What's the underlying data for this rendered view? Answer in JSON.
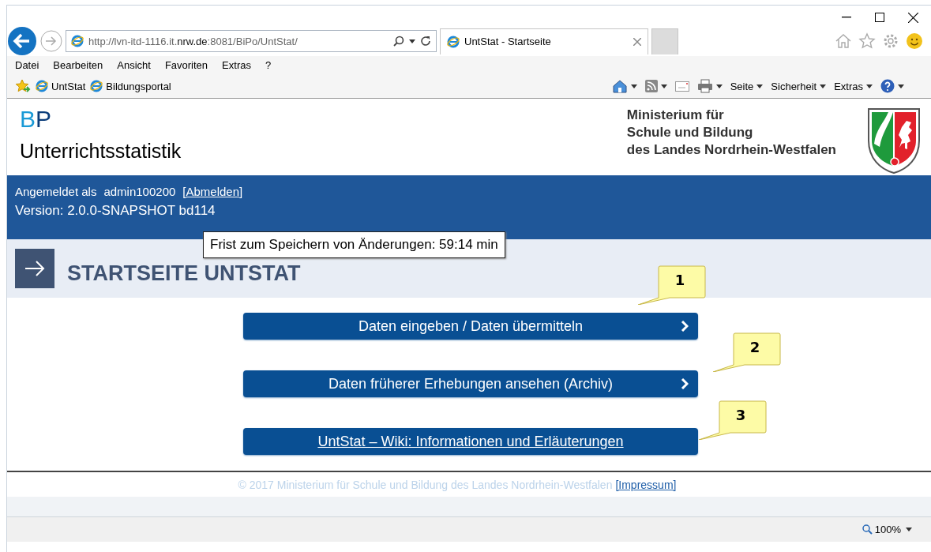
{
  "address_bar": {
    "url": "http://lvn-itd-1116.it.**nrw.de**:8081/BiPo/UntStat/"
  },
  "tabs": [
    {
      "title": "UntStat - Startseite",
      "selected": true
    }
  ],
  "menu_bar": [
    "Datei",
    "Bearbeiten",
    "Ansicht",
    "Favoriten",
    "Extras",
    "?"
  ],
  "favorites_bar": [
    "UntStat",
    "Bildungsportal"
  ],
  "command_bar": [
    {
      "kind": "home"
    },
    {
      "kind": "feeds"
    },
    {
      "kind": "mail"
    },
    {
      "kind": "print"
    },
    {
      "kind": "menu",
      "label": "Seite"
    },
    {
      "kind": "menu",
      "label": "Sicherheit"
    },
    {
      "kind": "menu",
      "label": "Extras"
    },
    {
      "kind": "help"
    }
  ],
  "header": {
    "logo": "BP",
    "app_title": "Unterrichtsstatistik",
    "ministry": [
      "Ministerium für",
      "Schule und Bildung",
      "des Landes Nordrhein-Westfalen"
    ]
  },
  "user_band": {
    "label": "Angemeldet als",
    "user": "admin100200",
    "logout": "[Abmelden]",
    "version": "Version: 2.0.0-SNAPSHOT bd114"
  },
  "tooltip": "Frist zum Speichern von Änderungen: 59:14 min",
  "page_title": "STARTSEITE UNTSTAT",
  "actions": [
    {
      "label": "Daten eingeben / Daten übermitteln",
      "kind": "arrow"
    },
    {
      "label": "Daten früherer Erhebungen ansehen (Archiv)",
      "kind": "arrow"
    },
    {
      "label": "UntStat – Wiki: Informationen und Erläuterungen",
      "kind": "link"
    }
  ],
  "callouts": [
    "1",
    "2",
    "3"
  ],
  "footer": {
    "copyright": "© 2017 Ministerium für Schule und Bildung des Landes Nordrhein-Westfalen",
    "impressum": "[Impressum]"
  },
  "status_bar": {
    "zoom": "100%"
  }
}
